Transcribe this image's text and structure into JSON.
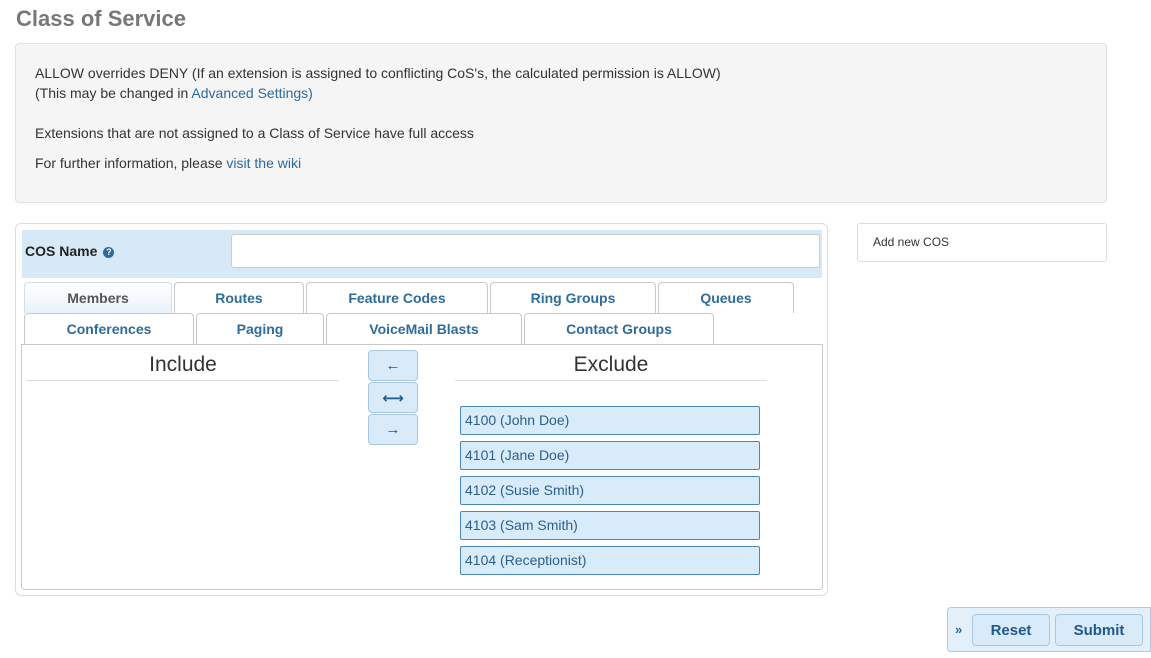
{
  "page": {
    "title": "Class of Service"
  },
  "info": {
    "line1": "ALLOW overrides DENY (If an extension is assigned to conflicting CoS's, the calculated permission is ALLOW)",
    "line2_prefix": "(This may be changed in ",
    "line2_link": "Advanced Settings)",
    "line3": "Extensions that are not assigned to a Class of Service have full access",
    "line4_prefix": "For further information, please ",
    "line4_link": "visit the wiki"
  },
  "form": {
    "cos_name_label": "COS Name",
    "help_icon": "question-circle-icon",
    "cos_name_value": ""
  },
  "tabs": {
    "members": "Members",
    "routes": "Routes",
    "feature_codes": "Feature Codes",
    "ring_groups": "Ring Groups",
    "queues": "Queues",
    "conferences": "Conferences",
    "paging": "Paging",
    "voicemail_blasts": "VoiceMail Blasts",
    "contact_groups": "Contact Groups",
    "active": "Members"
  },
  "members": {
    "include_header": "Include",
    "exclude_header": "Exclude",
    "include_items": [],
    "exclude_items": [
      "4100 (John Doe)",
      "4101 (Jane Doe)",
      "4102 (Susie Smith)",
      "4103 (Sam Smith)",
      "4104 (Receptionist)"
    ],
    "move_left_icon": "←",
    "swap_icon": "⟷",
    "move_right_icon": "→"
  },
  "sidebar": {
    "add_new_cos": "Add new COS"
  },
  "actions": {
    "collapse_icon": "»",
    "reset": "Reset",
    "submit": "Submit"
  },
  "colors": {
    "link": "#2b6a9e",
    "accent_bg": "#d7e9f6",
    "item_border": "#4a87b5"
  }
}
